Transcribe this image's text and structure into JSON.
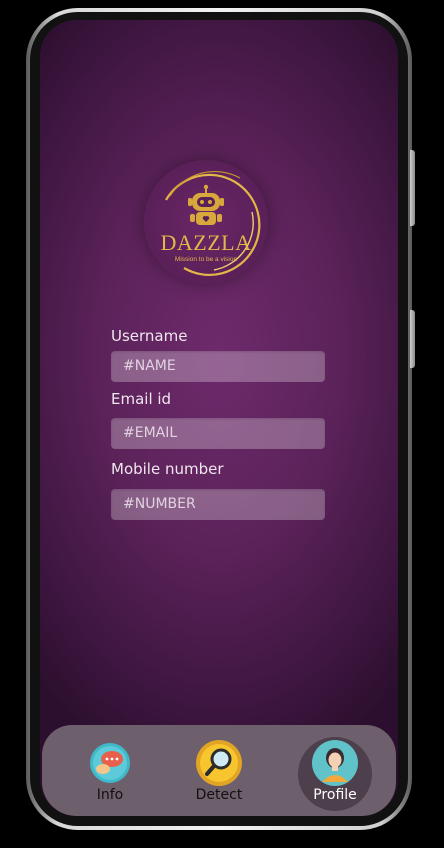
{
  "app": {
    "logo": {
      "title": "DAZZLA",
      "tagline": "Mission to be a vision",
      "icon": "robot-icon",
      "color": "#e2b64a"
    }
  },
  "form": {
    "username": {
      "label": "Username",
      "placeholder": "#NAME"
    },
    "email": {
      "label": "Email id",
      "placeholder": "#EMAIL"
    },
    "mobile": {
      "label": "Mobile number",
      "placeholder": "#NUMBER"
    }
  },
  "nav": {
    "items": [
      {
        "label": "Info",
        "icon": "chat-bubble-icon",
        "active": false
      },
      {
        "label": "Detect",
        "icon": "magnifier-icon",
        "active": false
      },
      {
        "label": "Profile",
        "icon": "user-avatar-icon",
        "active": true
      }
    ]
  },
  "colors": {
    "background": "#5b2259",
    "nav_bar": "#6e5f6d",
    "accent_gold": "#e2b64a"
  }
}
